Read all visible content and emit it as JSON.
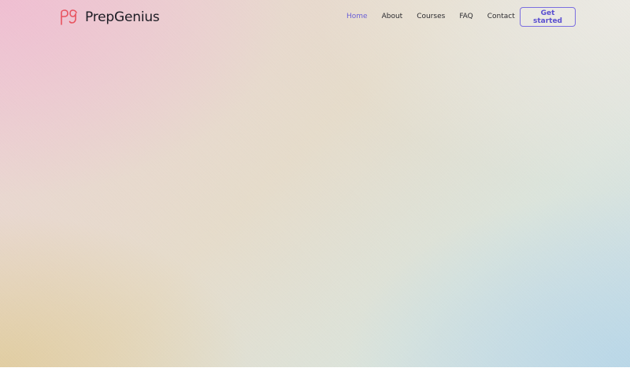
{
  "brand": {
    "name": "PrepGenius",
    "logo_icon": "pg-monogram-icon",
    "logo_color": "#e8535f"
  },
  "nav": {
    "items": [
      {
        "label": "Home",
        "active": true
      },
      {
        "label": "About",
        "active": false
      },
      {
        "label": "Courses",
        "active": false
      },
      {
        "label": "FAQ",
        "active": false
      },
      {
        "label": "Contact",
        "active": false
      }
    ],
    "active_color": "#6a5fd6"
  },
  "cta": {
    "label": "Get started",
    "accent_color": "#7b6fe0"
  }
}
